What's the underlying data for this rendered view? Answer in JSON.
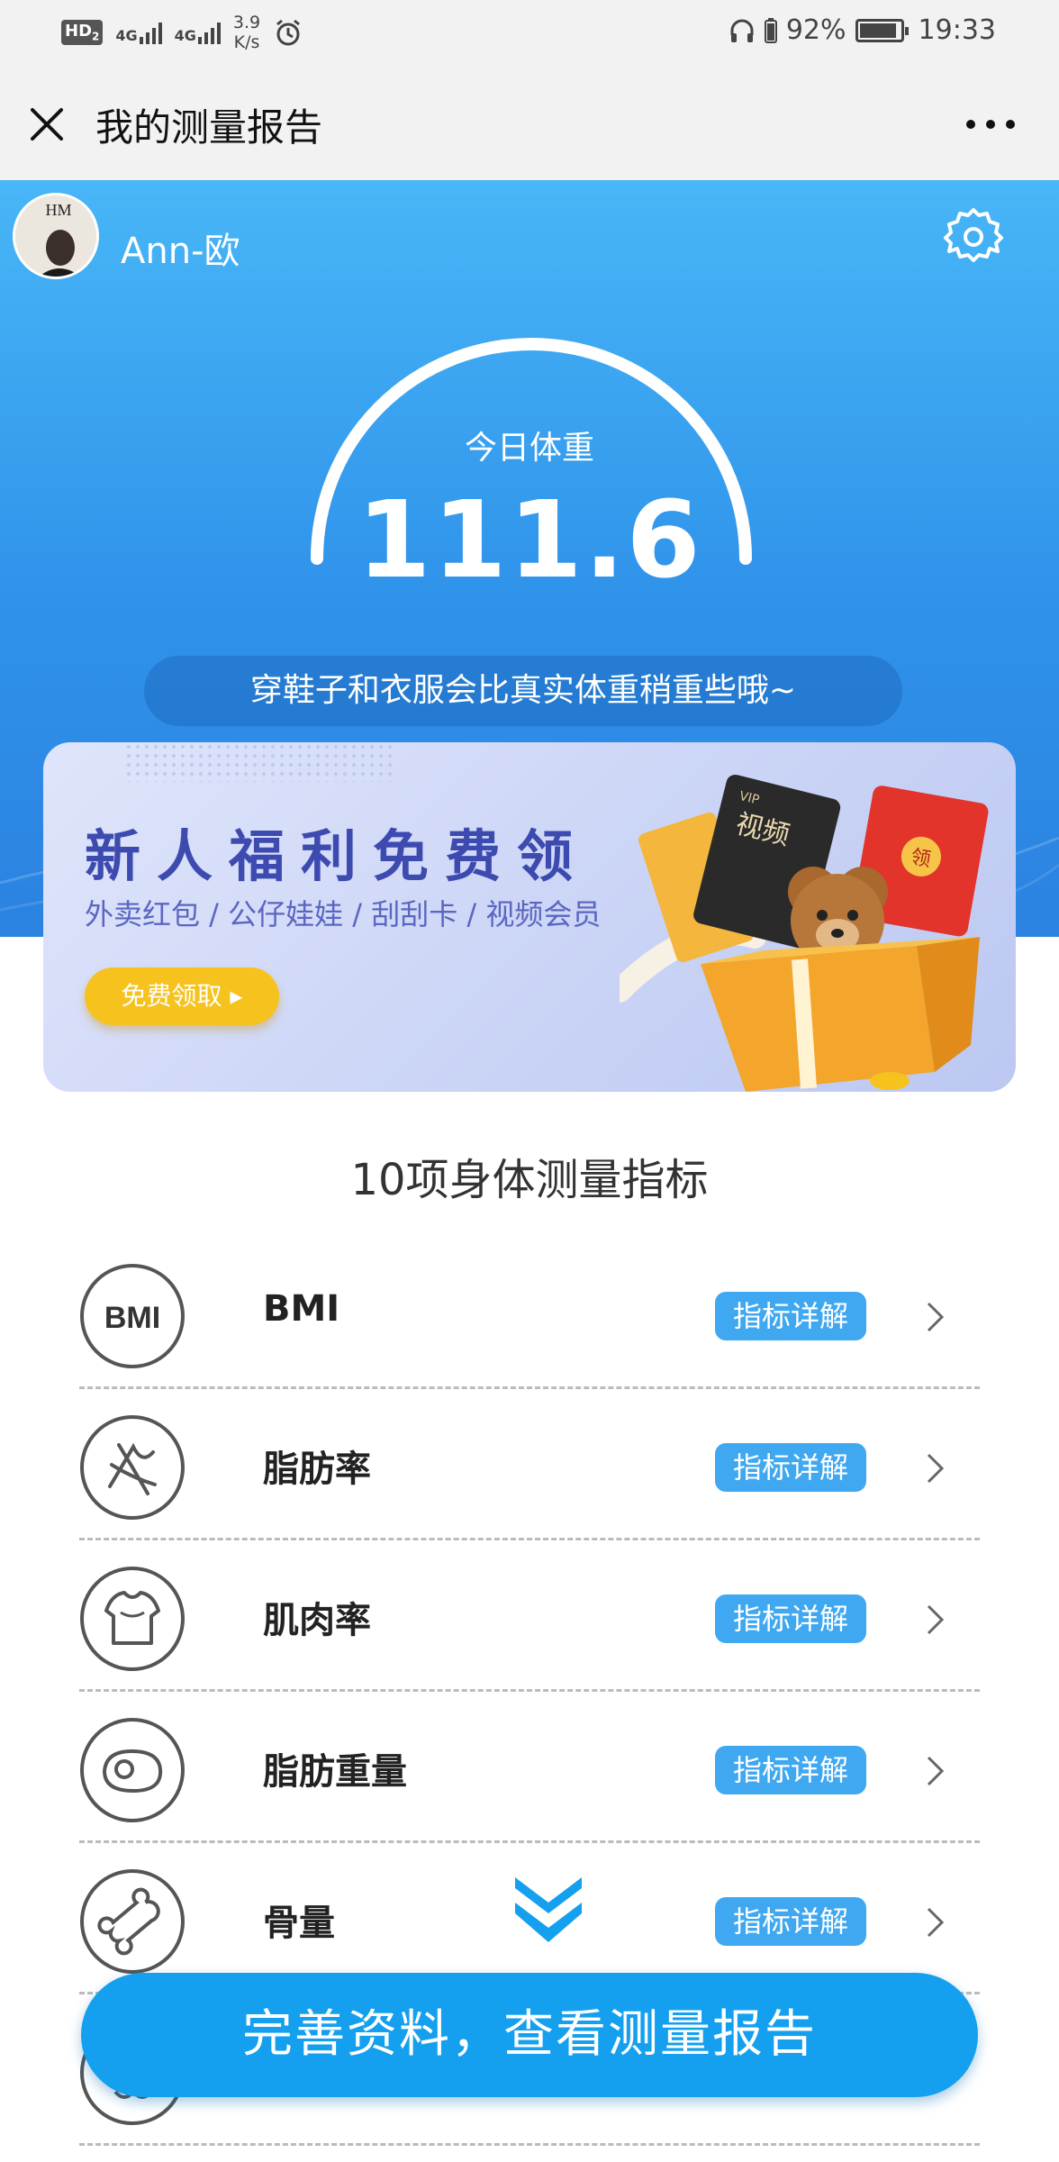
{
  "status_bar": {
    "hd": "HD",
    "hd_sub": "2",
    "sig1": "4G",
    "sig2": "4G",
    "speed_value": "3.9",
    "speed_unit": "K/s",
    "battery": "92%",
    "battery_level": 0.92,
    "time": "19:33"
  },
  "title_bar": {
    "title": "我的测量报告"
  },
  "profile": {
    "username": "Ann-欧",
    "avatar_text": "HM"
  },
  "weight": {
    "label": "今日体重",
    "value": "111.6"
  },
  "hint": "穿鞋子和衣服会比真实体重稍重些哦~",
  "banner": {
    "title": "新人福利免费领",
    "subtitle": "外卖红包 / 公仔娃娃 / 刮刮卡 / 视频会员",
    "button_label": "免费领取 ▸",
    "card_vip": "VIP",
    "card_text": "视频",
    "envelope_text": "领"
  },
  "metrics": {
    "section_title": "10项身体测量指标",
    "detail_label": "指标详解",
    "items": [
      {
        "name": "BMI",
        "icon": "bmi-icon"
      },
      {
        "name": "脂肪率",
        "icon": "fat-rate-icon"
      },
      {
        "name": "肌肉率",
        "icon": "muscle-rate-icon"
      },
      {
        "name": "脂肪重量",
        "icon": "fat-weight-icon"
      },
      {
        "name": "骨量",
        "icon": "bone-icon"
      },
      {
        "name": "",
        "icon": "partial-icon"
      }
    ]
  },
  "cta": {
    "label": "完善资料，查看测量报告"
  },
  "colors": {
    "brand_blue": "#2f93ea",
    "cta_blue": "#14a0ef",
    "badge_blue": "#40a8f0",
    "promo_yellow": "#f6c21e"
  }
}
